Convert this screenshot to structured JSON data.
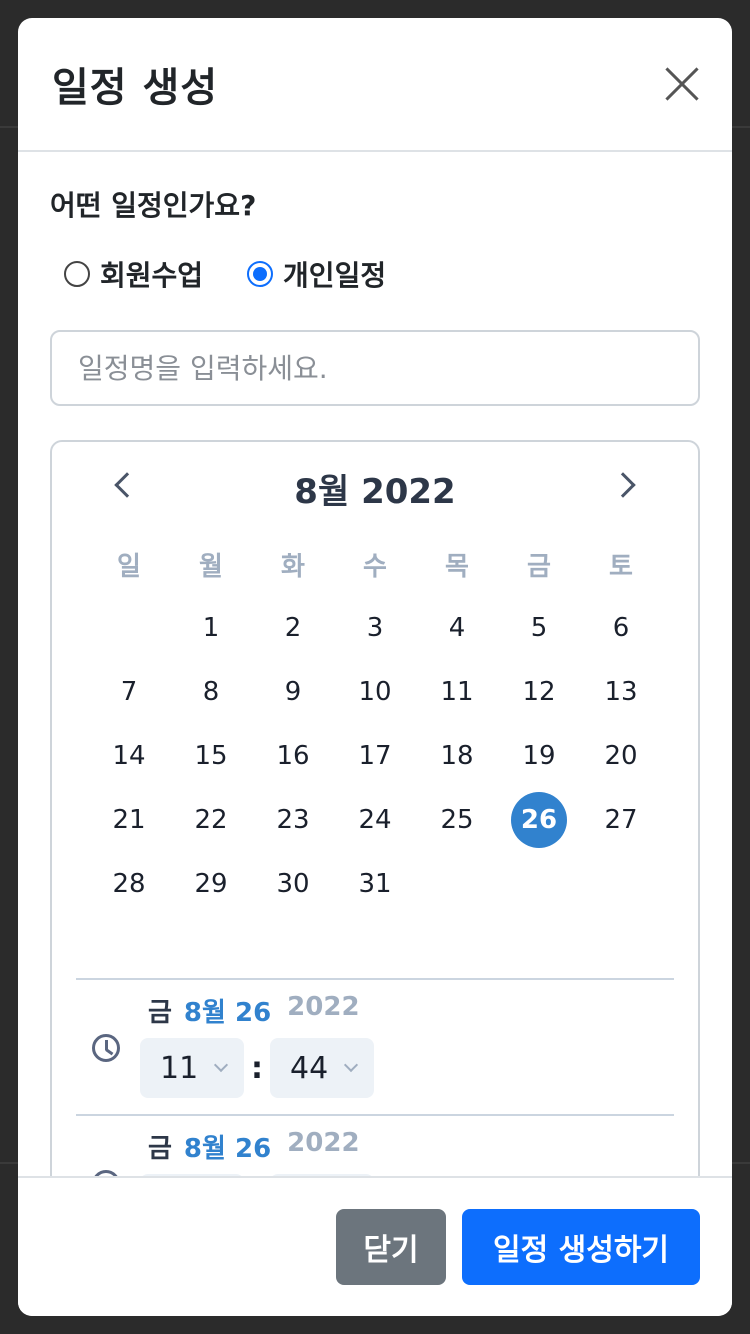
{
  "modal": {
    "title": "일정 생성",
    "question": "어떤 일정인가요?",
    "radios": [
      {
        "label": "회원수업",
        "checked": false
      },
      {
        "label": "개인일정",
        "checked": true
      }
    ],
    "name_placeholder": "일정명을 입력하세요.",
    "name_value": ""
  },
  "calendar": {
    "title": "8월 2022",
    "weekdays": [
      "일",
      "월",
      "화",
      "수",
      "목",
      "금",
      "토"
    ],
    "weeks": [
      [
        "",
        "1",
        "2",
        "3",
        "4",
        "5",
        "6"
      ],
      [
        "7",
        "8",
        "9",
        "10",
        "11",
        "12",
        "13"
      ],
      [
        "14",
        "15",
        "16",
        "17",
        "18",
        "19",
        "20"
      ],
      [
        "21",
        "22",
        "23",
        "24",
        "25",
        "26",
        "27"
      ],
      [
        "28",
        "29",
        "30",
        "31",
        "",
        "",
        ""
      ]
    ],
    "selected_day": "26"
  },
  "start_time": {
    "dow": "금",
    "date": "8월 26",
    "year": "2022",
    "hour": "11",
    "minute": "44"
  },
  "end_time": {
    "dow": "금",
    "date": "8월 26",
    "year": "2022"
  },
  "time_separator": ":",
  "footer": {
    "close_label": "닫기",
    "create_label": "일정 생성하기"
  },
  "colors": {
    "primary": "#0d6efd",
    "selected_day": "#3182ce",
    "secondary": "#6c757d"
  }
}
